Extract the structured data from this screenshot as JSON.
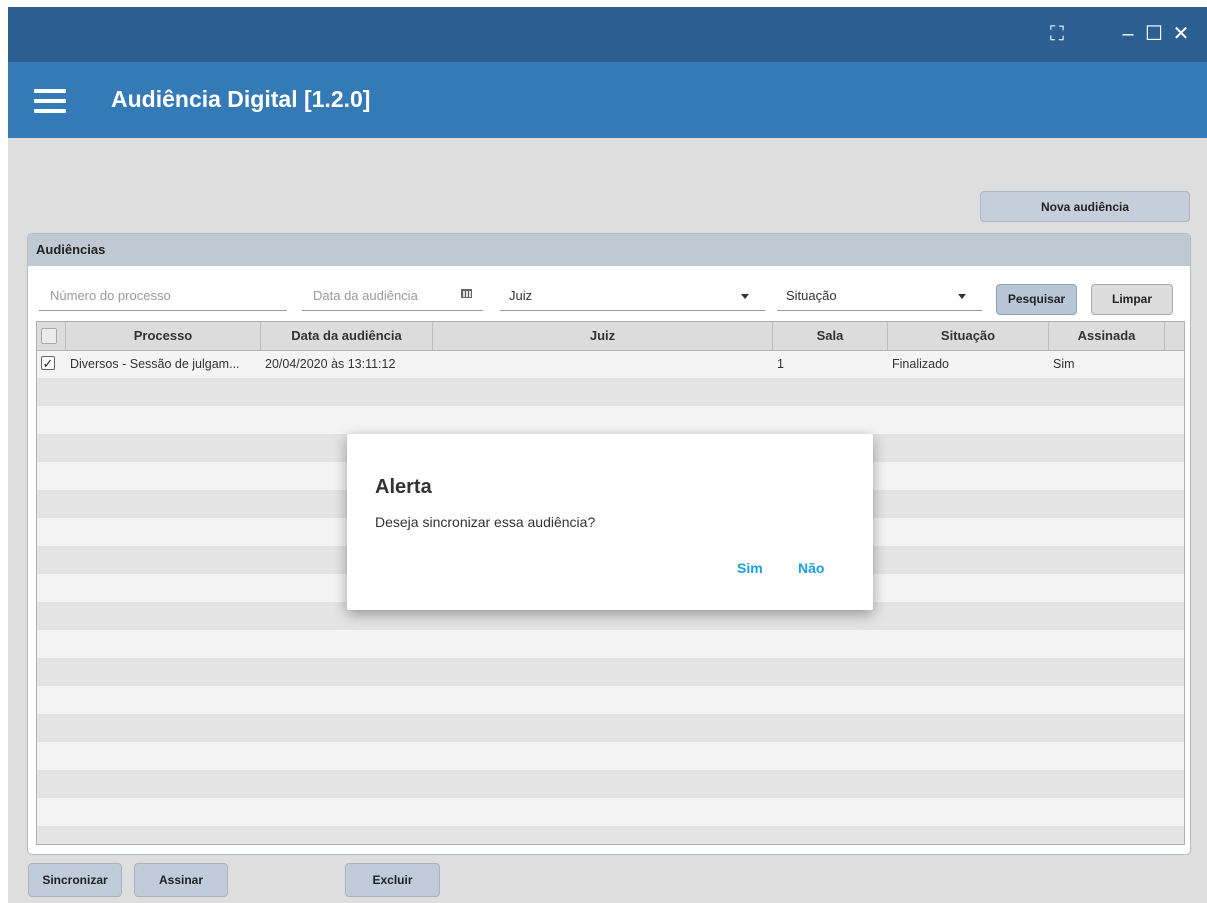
{
  "window": {
    "fullscreen_icon": "fullscreen-icon",
    "minimize_icon": "minimize-icon",
    "maximize_icon": "maximize-icon",
    "close_icon": "close-icon",
    "fullscreen_glyph": "⛶",
    "minimize_glyph": "–",
    "maximize_glyph": "☐",
    "close_glyph": "✕"
  },
  "appbar": {
    "title": "Audiência Digital [1.2.0]",
    "menu_icon": "hamburger-menu-icon"
  },
  "toolbar": {
    "new_button": "Nova audiência"
  },
  "panel": {
    "title": "Audiências",
    "filters": {
      "process_placeholder": "Número do processo",
      "date_placeholder": "Data da audiência",
      "judge_value": "Juiz",
      "status_value": "Situação",
      "search_button": "Pesquisar",
      "clear_button": "Limpar"
    }
  },
  "table": {
    "columns": [
      "Processo",
      "Data da audiência",
      "Juiz",
      "Sala",
      "Situação",
      "Assinada"
    ],
    "rows": [
      {
        "checked": true,
        "check_glyph": "✓",
        "processo": "Diversos - Sessão de julgam...",
        "data": "20/04/2020 às 13:11:12",
        "juiz": "",
        "sala": "1",
        "situacao": "Finalizado",
        "assinada": "Sim"
      }
    ]
  },
  "footer": {
    "sync_button": "Sincronizar",
    "sign_button": "Assinar",
    "delete_button": "Excluir"
  },
  "dialog": {
    "title": "Alerta",
    "message": "Deseja sincronizar essa audiência?",
    "yes_button": "Sim",
    "no_button": "Não"
  },
  "colors": {
    "titlebar": "#2c5f91",
    "appbar": "#337ab7",
    "dialog_button": "#1aa0e6"
  }
}
